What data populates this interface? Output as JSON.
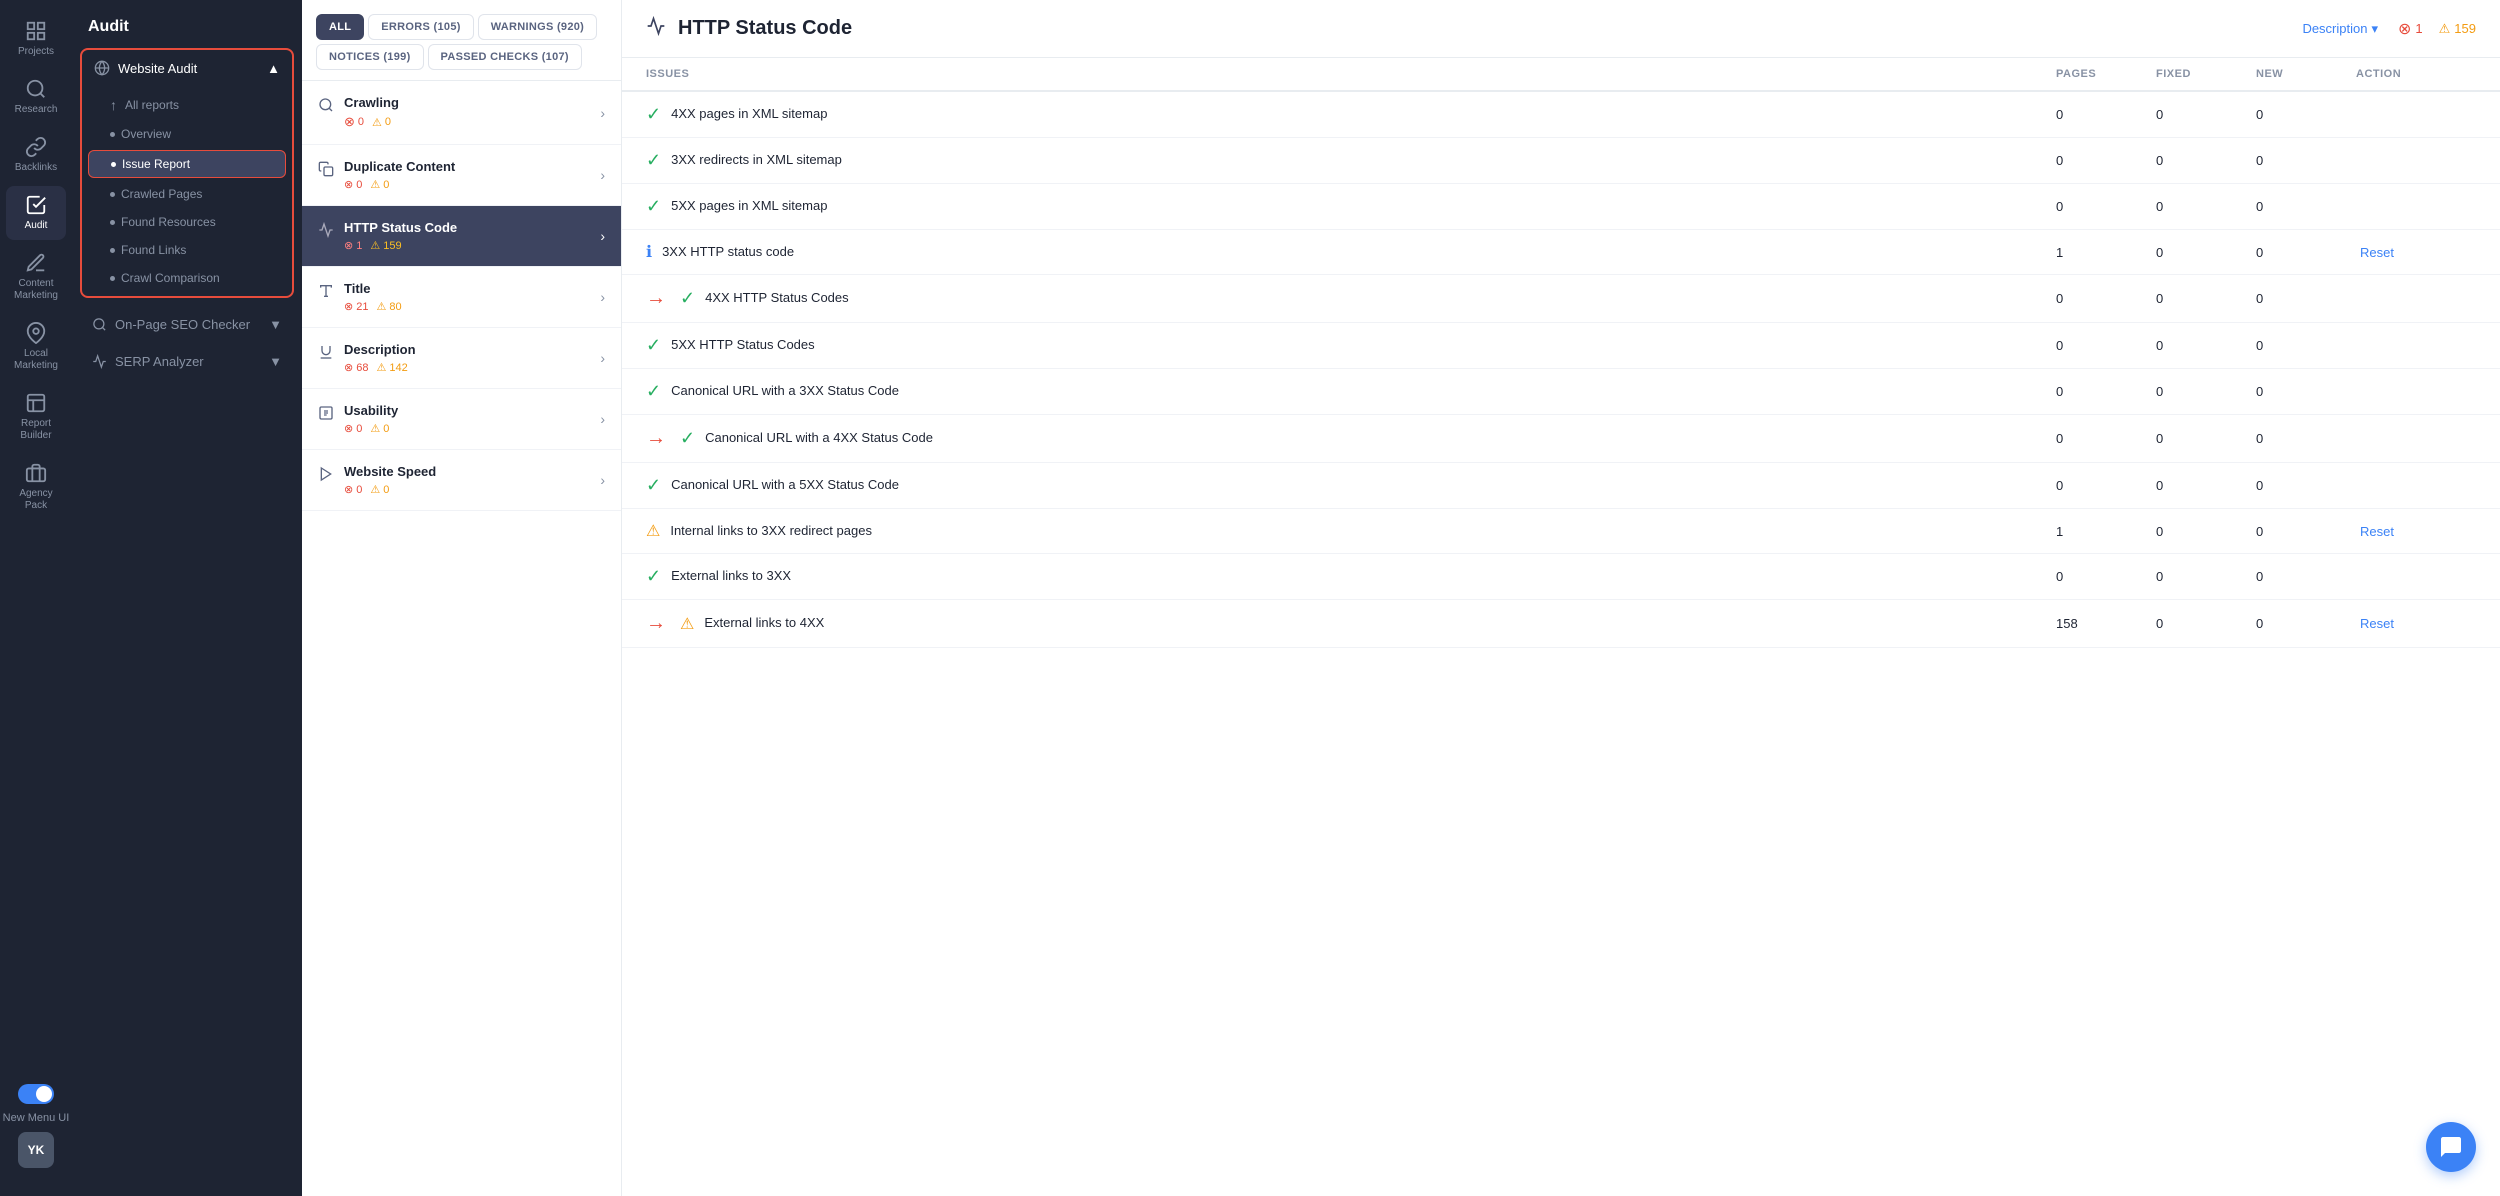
{
  "app": {
    "title": "Audit"
  },
  "icon_nav": {
    "items": [
      {
        "id": "projects",
        "label": "Projects",
        "icon": "home"
      },
      {
        "id": "research",
        "label": "Research",
        "icon": "search"
      },
      {
        "id": "backlinks",
        "label": "Backlinks",
        "icon": "link"
      },
      {
        "id": "audit",
        "label": "Audit",
        "icon": "audit",
        "active": true
      },
      {
        "id": "content-marketing",
        "label": "Content Marketing",
        "icon": "content"
      },
      {
        "id": "local-marketing",
        "label": "Local Marketing",
        "icon": "local"
      },
      {
        "id": "report-builder",
        "label": "Report Builder",
        "icon": "report"
      },
      {
        "id": "agency-pack",
        "label": "Agency Pack",
        "icon": "agency"
      }
    ],
    "avatar": "YK",
    "toggle_label": "New Menu UI"
  },
  "sidebar": {
    "title": "Audit",
    "website_audit": {
      "label": "Website Audit",
      "items": [
        {
          "id": "all-reports",
          "label": "All reports",
          "type": "back"
        },
        {
          "id": "overview",
          "label": "Overview"
        },
        {
          "id": "issue-report",
          "label": "Issue Report",
          "active": true
        },
        {
          "id": "crawled-pages",
          "label": "Crawled Pages"
        },
        {
          "id": "found-resources",
          "label": "Found Resources"
        },
        {
          "id": "found-links",
          "label": "Found Links"
        },
        {
          "id": "crawl-comparison",
          "label": "Crawl Comparison"
        }
      ]
    },
    "other_sections": [
      {
        "id": "on-page-seo-checker",
        "label": "On-Page SEO Checker",
        "has_chevron": true
      },
      {
        "id": "serp-analyzer",
        "label": "SERP Analyzer",
        "has_chevron": true
      }
    ]
  },
  "filter_tabs": [
    {
      "id": "all",
      "label": "ALL",
      "active": true
    },
    {
      "id": "errors",
      "label": "ERRORS (105)"
    },
    {
      "id": "warnings",
      "label": "WARNINGS (920)"
    },
    {
      "id": "notices",
      "label": "NOTICES (199)"
    },
    {
      "id": "passed",
      "label": "PASSED CHECKS (107)"
    }
  ],
  "categories": [
    {
      "id": "crawling",
      "label": "Crawling",
      "icon": "search",
      "errors": 0,
      "warnings": 0,
      "has_arrow": false
    },
    {
      "id": "duplicate-content",
      "label": "Duplicate Content",
      "icon": "copy",
      "errors": 0,
      "warnings": 0,
      "has_arrow": false
    },
    {
      "id": "http-status-code",
      "label": "HTTP Status Code",
      "icon": "activity",
      "errors": 1,
      "warnings": 159,
      "active": true,
      "has_arrow": true
    },
    {
      "id": "title",
      "label": "Title",
      "icon": "title",
      "errors": 21,
      "warnings": 80,
      "has_arrow": false
    },
    {
      "id": "description",
      "label": "Description",
      "icon": "underline",
      "errors": 68,
      "warnings": 142,
      "has_arrow": false
    },
    {
      "id": "usability",
      "label": "Usability",
      "icon": "usability",
      "errors": 0,
      "warnings": 0,
      "has_arrow": false
    },
    {
      "id": "website-speed",
      "label": "Website Speed",
      "icon": "speed",
      "errors": 0,
      "warnings": 0,
      "has_arrow": false
    }
  ],
  "detail_panel": {
    "title": "HTTP Status Code",
    "description_label": "Description",
    "error_count": 1,
    "warning_count": 159,
    "table_headers": {
      "issues": "ISSUES",
      "pages": "PAGES",
      "fixed": "FIXED",
      "new": "NEW",
      "action": "ACTION"
    },
    "rows": [
      {
        "id": "4xx-xml",
        "icon": "passed",
        "issue": "4XX pages in XML sitemap",
        "pages": 0,
        "fixed": 0,
        "new": 0,
        "action": ""
      },
      {
        "id": "3xx-xml",
        "icon": "passed",
        "issue": "3XX redirects in XML sitemap",
        "pages": 0,
        "fixed": 0,
        "new": 0,
        "action": ""
      },
      {
        "id": "5xx-xml",
        "icon": "passed",
        "issue": "5XX pages in XML sitemap",
        "pages": 0,
        "fixed": 0,
        "new": 0,
        "action": ""
      },
      {
        "id": "3xx-http",
        "icon": "info",
        "issue": "3XX HTTP status code",
        "pages": 1,
        "fixed": 0,
        "new": 0,
        "action": "Reset"
      },
      {
        "id": "4xx-http",
        "icon": "passed",
        "issue": "4XX HTTP Status Codes",
        "pages": 0,
        "fixed": 0,
        "new": 0,
        "action": "",
        "has_arrow": true
      },
      {
        "id": "5xx-http",
        "icon": "passed",
        "issue": "5XX HTTP Status Codes",
        "pages": 0,
        "fixed": 0,
        "new": 0,
        "action": ""
      },
      {
        "id": "canonical-3xx",
        "icon": "passed",
        "issue": "Canonical URL with a 3XX Status Code",
        "pages": 0,
        "fixed": 0,
        "new": 0,
        "action": ""
      },
      {
        "id": "canonical-4xx",
        "icon": "passed",
        "issue": "Canonical URL with a 4XX Status Code",
        "pages": 0,
        "fixed": 0,
        "new": 0,
        "action": "",
        "has_arrow": true
      },
      {
        "id": "canonical-5xx",
        "icon": "passed",
        "issue": "Canonical URL with a 5XX Status Code",
        "pages": 0,
        "fixed": 0,
        "new": 0,
        "action": ""
      },
      {
        "id": "internal-3xx",
        "icon": "warning",
        "issue": "Internal links to 3XX redirect pages",
        "pages": 1,
        "fixed": 0,
        "new": 0,
        "action": "Reset"
      },
      {
        "id": "external-3xx",
        "icon": "passed",
        "issue": "External links to 3XX",
        "pages": 0,
        "fixed": 0,
        "new": 0,
        "action": ""
      },
      {
        "id": "external-4xx",
        "icon": "warning",
        "issue": "External links to 4XX",
        "pages": 158,
        "fixed": 0,
        "new": 0,
        "action": "Reset",
        "has_arrow": true
      }
    ]
  }
}
